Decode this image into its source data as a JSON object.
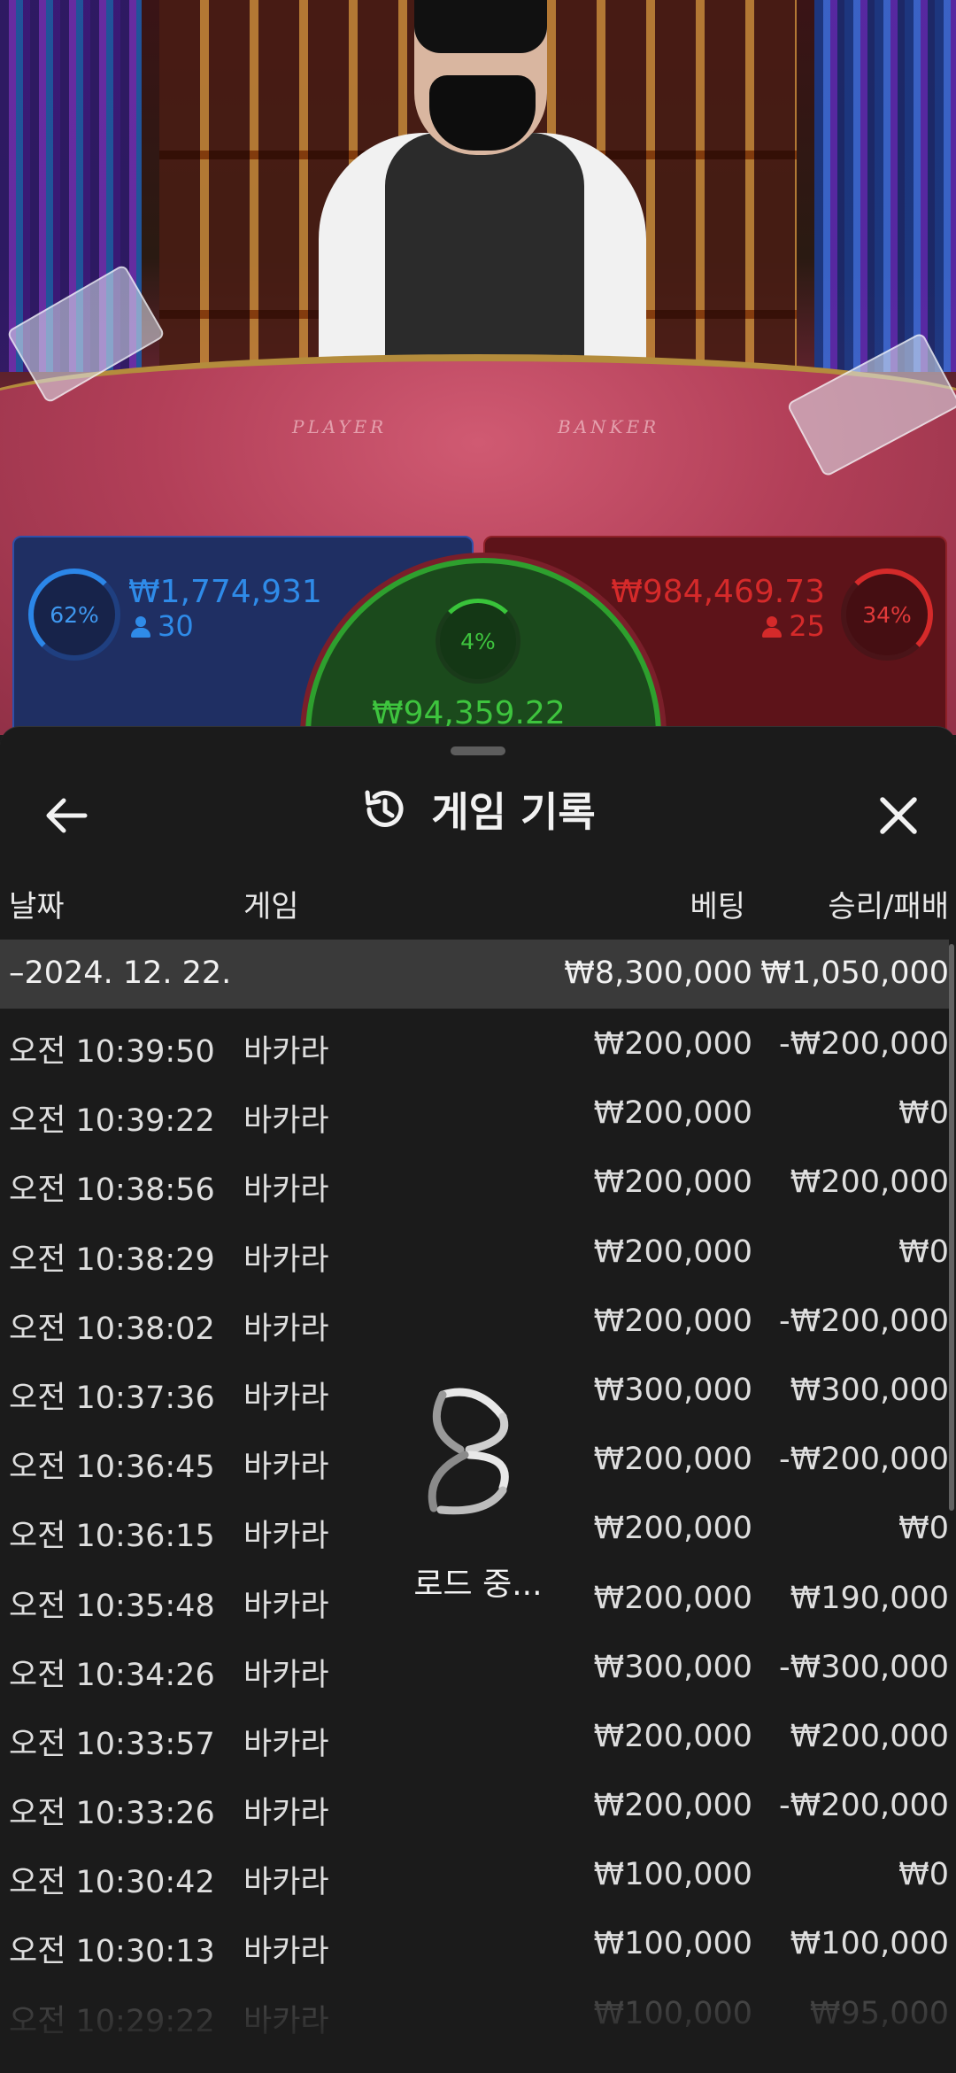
{
  "scene": {
    "felt_player": "PLAYER",
    "felt_banker": "BANKER",
    "player": {
      "percent": "62%",
      "amount": "₩1,774,931",
      "count": "30",
      "color": "#2b86e8"
    },
    "banker": {
      "percent": "34%",
      "amount": "₩984,469.73",
      "count": "25",
      "color": "#d52a2a"
    },
    "tie": {
      "percent": "4%",
      "amount": "₩94,359.22",
      "color": "#3ec43e"
    }
  },
  "sheet": {
    "title": "게임 기록",
    "icons": {
      "back": "back-arrow-icon",
      "history": "history-icon",
      "close": "close-icon"
    },
    "columns": {
      "date": "날짜",
      "game": "게임",
      "bet": "베팅",
      "result": "승리/패배"
    },
    "date_group": {
      "label": "–2024. 12. 22.",
      "bet_total": "₩8,300,000",
      "result_total": "₩1,050,000"
    },
    "rows": [
      {
        "time": "오전 10:39:50",
        "game": "바카라",
        "bet": "₩200,000",
        "result": "-₩200,000"
      },
      {
        "time": "오전 10:39:22",
        "game": "바카라",
        "bet": "₩200,000",
        "result": "₩0"
      },
      {
        "time": "오전 10:38:56",
        "game": "바카라",
        "bet": "₩200,000",
        "result": "₩200,000"
      },
      {
        "time": "오전 10:38:29",
        "game": "바카라",
        "bet": "₩200,000",
        "result": "₩0"
      },
      {
        "time": "오전 10:38:02",
        "game": "바카라",
        "bet": "₩200,000",
        "result": "-₩200,000"
      },
      {
        "time": "오전 10:37:36",
        "game": "바카라",
        "bet": "₩300,000",
        "result": "₩300,000"
      },
      {
        "time": "오전 10:36:45",
        "game": "바카라",
        "bet": "₩200,000",
        "result": "-₩200,000"
      },
      {
        "time": "오전 10:36:15",
        "game": "바카라",
        "bet": "₩200,000",
        "result": "₩0"
      },
      {
        "time": "오전 10:35:48",
        "game": "바카라",
        "bet": "₩200,000",
        "result": "₩190,000"
      },
      {
        "time": "오전 10:34:26",
        "game": "바카라",
        "bet": "₩300,000",
        "result": "-₩300,000"
      },
      {
        "time": "오전 10:33:57",
        "game": "바카라",
        "bet": "₩200,000",
        "result": "₩200,000"
      },
      {
        "time": "오전 10:33:26",
        "game": "바카라",
        "bet": "₩200,000",
        "result": "-₩200,000"
      },
      {
        "time": "오전 10:30:42",
        "game": "바카라",
        "bet": "₩100,000",
        "result": "₩0"
      },
      {
        "time": "오전 10:30:13",
        "game": "바카라",
        "bet": "₩100,000",
        "result": "₩100,000"
      },
      {
        "time": "오전 10:29:22",
        "game": "바카라",
        "bet": "₩100,000",
        "result": "₩95,000"
      }
    ],
    "loading": "로드 중..."
  }
}
